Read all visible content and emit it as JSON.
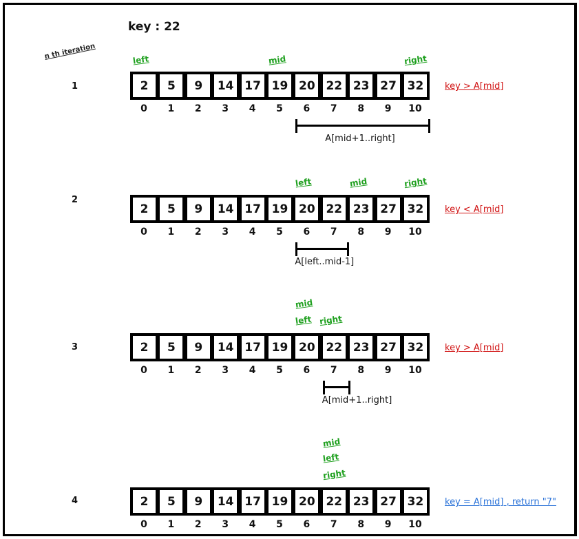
{
  "title": "key : 22",
  "iteration_header": "n th iteration",
  "array": [
    2,
    5,
    9,
    14,
    17,
    19,
    20,
    22,
    23,
    27,
    32
  ],
  "indices": [
    "0",
    "1",
    "2",
    "3",
    "4",
    "5",
    "6",
    "7",
    "8",
    "9",
    "10"
  ],
  "colors": {
    "pointer": "#1fa01f",
    "compare": "#d01010",
    "found": "#2a72d8"
  },
  "iterations": [
    {
      "n": "1",
      "pointers": [
        {
          "label": "left",
          "index": 0
        },
        {
          "label": "mid",
          "index": 5
        },
        {
          "label": "right",
          "index": 10
        }
      ],
      "condition": "key > A[mid]",
      "condition_type": "compare",
      "range_label": "A[mid+1..right]",
      "range": [
        6,
        10
      ]
    },
    {
      "n": "2",
      "pointers": [
        {
          "label": "left",
          "index": 6
        },
        {
          "label": "mid",
          "index": 8
        },
        {
          "label": "right",
          "index": 10
        }
      ],
      "condition": "key < A[mid]",
      "condition_type": "compare",
      "range_label": "A[left..mid-1]",
      "range": [
        6,
        7
      ]
    },
    {
      "n": "3",
      "pointers": [
        {
          "label": "mid",
          "index": 6
        },
        {
          "label": "left",
          "index": 6
        },
        {
          "label": "right",
          "index": 7
        }
      ],
      "condition": "key > A[mid]",
      "condition_type": "compare",
      "range_label": "A[mid+1..right]",
      "range": [
        7,
        7
      ]
    },
    {
      "n": "4",
      "pointers": [
        {
          "label": "mid",
          "index": 7
        },
        {
          "label": "left",
          "index": 7
        },
        {
          "label": "right",
          "index": 7
        }
      ],
      "condition": "key = A[mid] , return \"7\"",
      "condition_type": "found",
      "range_label": null,
      "range": null
    }
  ]
}
